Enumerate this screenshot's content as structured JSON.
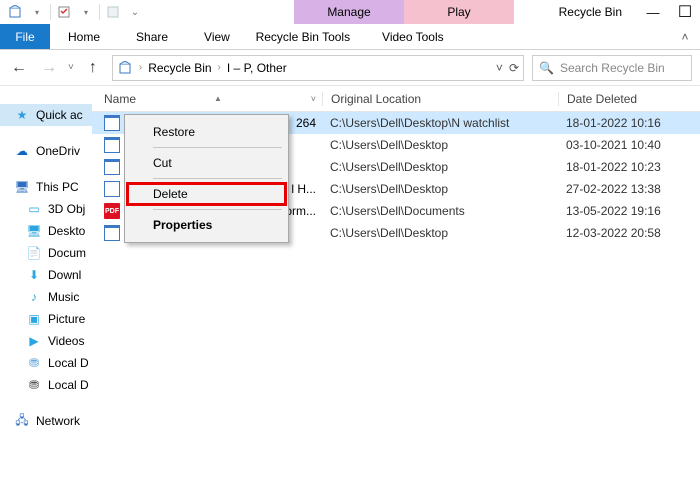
{
  "window": {
    "title": "Recycle Bin",
    "min": "—",
    "max": "☐",
    "close": "✕"
  },
  "contextual_tabs": {
    "manage": "Manage",
    "play": "Play",
    "manage_sub": "Recycle Bin Tools",
    "play_sub": "Video Tools"
  },
  "ribbon": {
    "file": "File",
    "home": "Home",
    "share": "Share",
    "view": "View"
  },
  "address": {
    "root": "Recycle Bin",
    "path": "I – P, Other"
  },
  "search": {
    "placeholder": "Search Recycle Bin"
  },
  "sidebar": {
    "items": [
      {
        "label": "Quick ac",
        "ico": "⭐",
        "color": "#2f9de0"
      },
      {
        "label": "OneDriv",
        "ico": "☁",
        "color": "#0a66c2"
      },
      {
        "label": "This PC",
        "ico": "🖥",
        "color": "#2f6fbf"
      },
      {
        "label": "3D Obj",
        "ico": "▭",
        "color": "#2aa6e0"
      },
      {
        "label": "Deskto",
        "ico": "🖥",
        "color": "#2aa6e0"
      },
      {
        "label": "Docum",
        "ico": "📄",
        "color": "#2aa6e0"
      },
      {
        "label": "Downl",
        "ico": "⬇",
        "color": "#2aa6e0"
      },
      {
        "label": "Music",
        "ico": "♪",
        "color": "#2aa6e0"
      },
      {
        "label": "Picture",
        "ico": "▣",
        "color": "#2aa6e0"
      },
      {
        "label": "Videos",
        "ico": "▶",
        "color": "#2aa6e0"
      },
      {
        "label": "Local D",
        "ico": "⛃",
        "color": "#6aa7d8"
      },
      {
        "label": "Local D",
        "ico": "⛃",
        "color": "#555"
      },
      {
        "label": "Network",
        "ico": "🖧",
        "color": "#2f6fbf"
      }
    ]
  },
  "columns": {
    "name": "Name",
    "orig": "Original Location",
    "date": "Date Deleted"
  },
  "rows": [
    {
      "ico": "doc",
      "name_tail": "264",
      "orig": "C:\\Users\\Dell\\Desktop\\N watchlist",
      "date": "18-01-2022 10:16",
      "sel": true
    },
    {
      "ico": "doc",
      "name_tail": "",
      "orig": "C:\\Users\\Dell\\Desktop",
      "date": "03-10-2021 10:40"
    },
    {
      "ico": "doc",
      "name_tail": "",
      "orig": "C:\\Users\\Dell\\Desktop",
      "date": "18-01-2022 10:23"
    },
    {
      "ico": "mkv",
      "name_tail": "l H...",
      "orig": "C:\\Users\\Dell\\Desktop",
      "date": "27-02-2022 13:38"
    },
    {
      "ico": "pdf",
      "name_tail": "orm...",
      "orig": "C:\\Users\\Dell\\Documents",
      "date": "13-05-2022 19:16"
    },
    {
      "ico": "doc",
      "name_tail": "",
      "orig": "C:\\Users\\Dell\\Desktop",
      "date": "12-03-2022 20:58"
    }
  ],
  "context_menu": {
    "restore": "Restore",
    "cut": "Cut",
    "delete": "Delete",
    "properties": "Properties"
  }
}
